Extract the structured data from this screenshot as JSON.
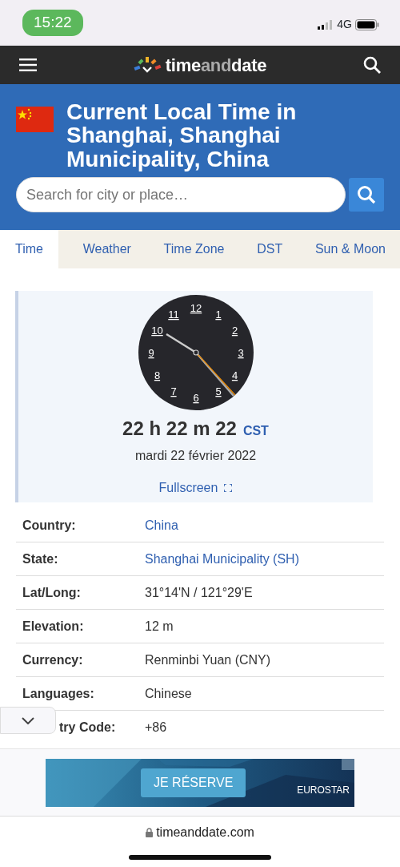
{
  "status_bar": {
    "time": "15:22",
    "network": "4G"
  },
  "navbar": {
    "logo": [
      {
        "text": "time",
        "muted": false
      },
      {
        "text": "and",
        "muted": true
      },
      {
        "text": "date",
        "muted": false
      }
    ]
  },
  "header": {
    "title": "Current Local Time in Shanghai, Shanghai Municipality, China",
    "search": {
      "placeholder": "Search for city or place…"
    }
  },
  "tabs": [
    {
      "label": "Time",
      "selected": true
    },
    {
      "label": "Weather",
      "selected": false
    },
    {
      "label": "Time Zone",
      "selected": false
    },
    {
      "label": "DST",
      "selected": false
    },
    {
      "label": "Sun & Moon",
      "selected": false
    }
  ],
  "clock": {
    "numerals": [
      "12",
      "1",
      "2",
      "3",
      "4",
      "5",
      "6",
      "7",
      "8",
      "9",
      "10",
      "11"
    ],
    "time": "22 h 22 m 22",
    "zone": "CST",
    "date": "mardi 22 février 2022",
    "fullscreen": "Fullscreen"
  },
  "facts": [
    {
      "label": "Country:",
      "value": "China",
      "link": true
    },
    {
      "label": "State:",
      "value": "Shanghai Municipality (SH)",
      "link": true
    },
    {
      "label": "Lat/Long:",
      "value": "31°14'N / 121°29'E",
      "link": false
    },
    {
      "label": "Elevation:",
      "value": "12 m",
      "link": false
    },
    {
      "label": "Currency:",
      "value": "Renminbi Yuan (CNY)",
      "link": false
    },
    {
      "label": "Languages:",
      "value": "Chinese",
      "link": false
    },
    {
      "label": "try Code:",
      "value": "+86",
      "link": false
    }
  ],
  "ad": {
    "button": "JE RÉSERVE",
    "brand": "EUROSTAR"
  },
  "address_bar": {
    "url": "timeanddate.com"
  }
}
